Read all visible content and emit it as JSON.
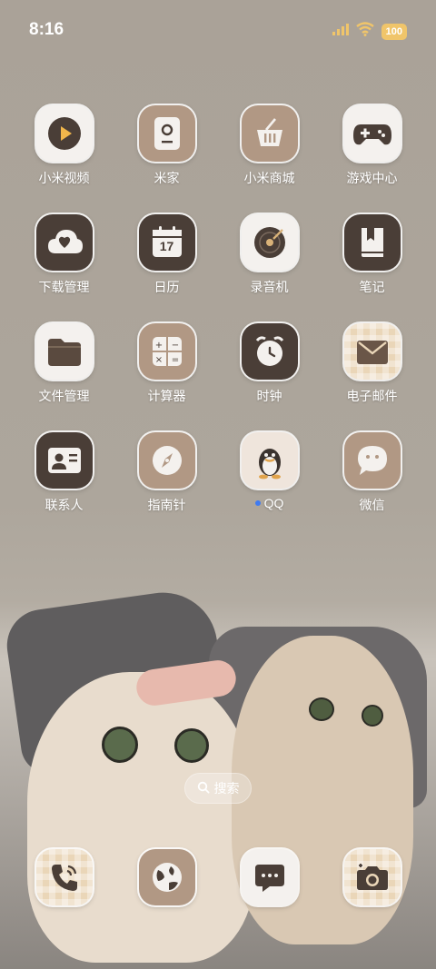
{
  "status": {
    "time": "8:16",
    "battery": "100"
  },
  "apps": [
    {
      "label": "小米视频"
    },
    {
      "label": "米家"
    },
    {
      "label": "小米商城"
    },
    {
      "label": "游戏中心"
    },
    {
      "label": "下载管理"
    },
    {
      "label": "日历",
      "calendar_day": "17"
    },
    {
      "label": "录音机"
    },
    {
      "label": "笔记"
    },
    {
      "label": "文件管理"
    },
    {
      "label": "计算器"
    },
    {
      "label": "时钟"
    },
    {
      "label": "电子邮件"
    },
    {
      "label": "联系人"
    },
    {
      "label": "指南针"
    },
    {
      "label": "QQ"
    },
    {
      "label": "微信"
    }
  ],
  "search": {
    "label": "搜索"
  },
  "colors": {
    "icon_brown": "#4a3e37",
    "icon_tan": "#b19884",
    "icon_light": "#f4f1ee",
    "new_badge_dot": "#3f7bf2",
    "battery": "#f0c56a"
  },
  "dock": [
    {
      "icon": "phone-icon"
    },
    {
      "icon": "browser-icon"
    },
    {
      "icon": "messages-icon"
    },
    {
      "icon": "camera-icon"
    }
  ]
}
